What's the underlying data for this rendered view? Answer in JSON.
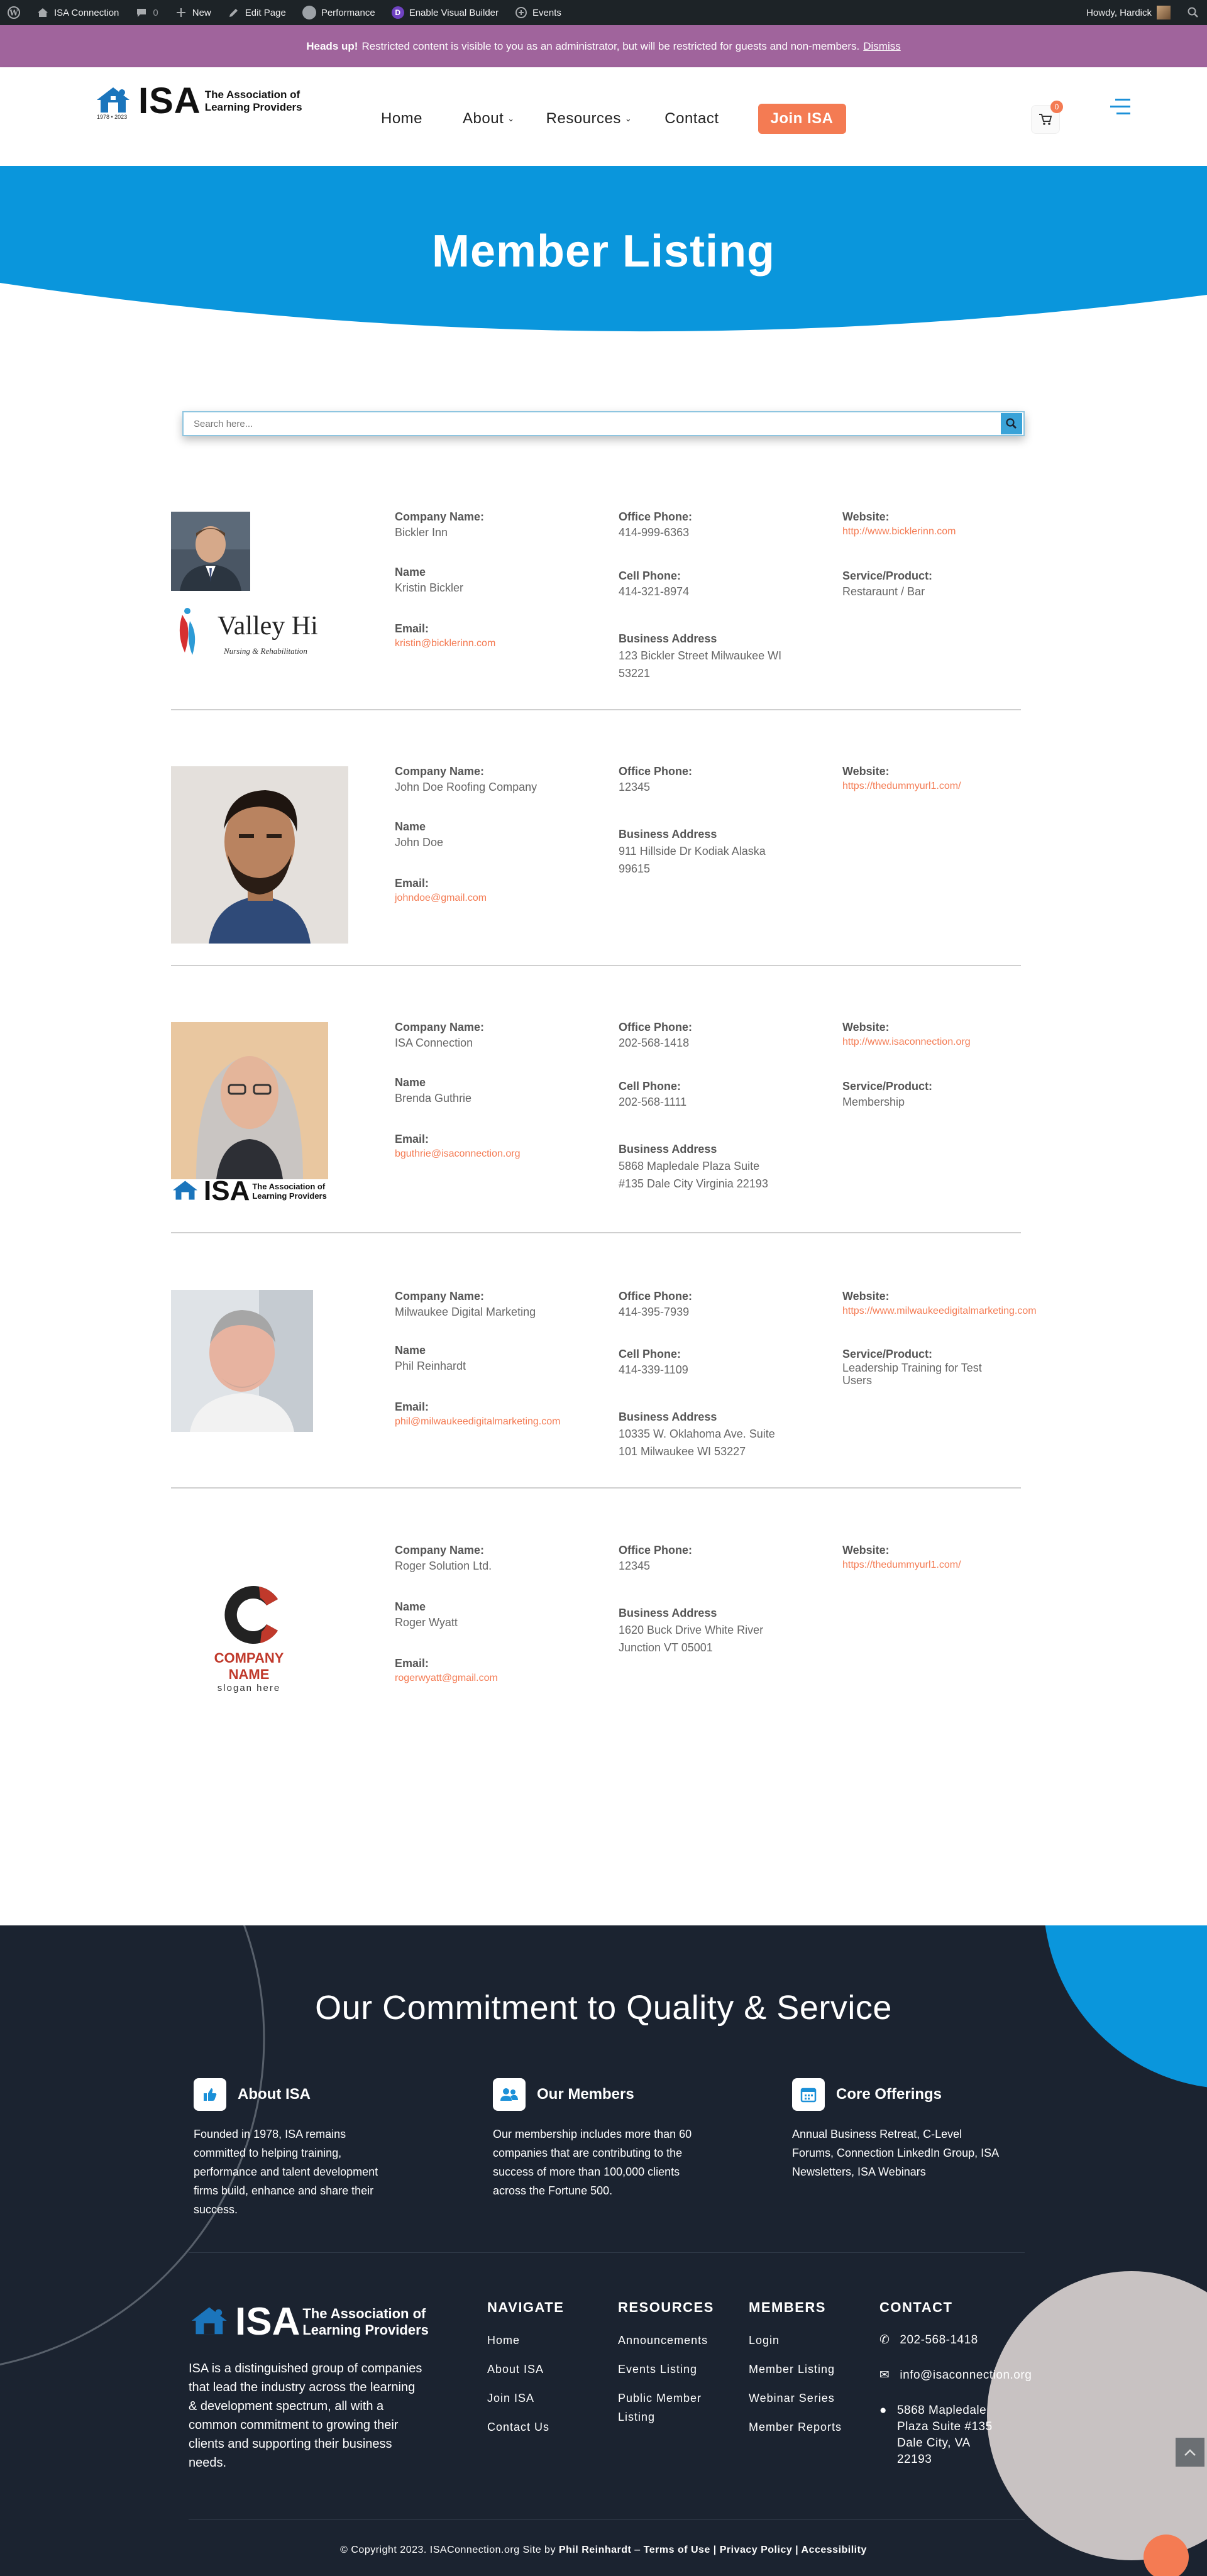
{
  "adminbar": {
    "site": "ISA Connection",
    "comments": "0",
    "new": "New",
    "edit_page": "Edit Page",
    "performance": "Performance",
    "visual_builder": "Enable Visual Builder",
    "events": "Events",
    "howdy": "Howdy, Hardick"
  },
  "notice": {
    "heading": "Heads up!",
    "text": "Restricted content is visible to you as an administrator, but will be restricted for guests and non-members.",
    "dismiss": "Dismiss"
  },
  "logo": {
    "isa": "ISA",
    "line1": "The Association of",
    "line2": "Learning Providers",
    "years": "1978 • 2023"
  },
  "nav": {
    "home": "Home",
    "about": "About",
    "resources": "Resources",
    "contact": "Contact",
    "join": "Join ISA",
    "cart_count": "0"
  },
  "hero": {
    "title": "Member Listing"
  },
  "search": {
    "placeholder": "Search here..."
  },
  "labels": {
    "company": "Company Name:",
    "name": "Name",
    "email": "Email:",
    "office_phone": "Office Phone:",
    "cell_phone": "Cell Phone:",
    "address": "Business Address",
    "website": "Website:",
    "service": "Service/Product:"
  },
  "members": [
    {
      "company": "Bickler Inn",
      "name": "Kristin Bickler",
      "email": "kristin@bicklerinn.com",
      "office_phone": "414-999-6363",
      "cell_phone": "414-321-8974",
      "address_1": "123 Bickler Street Milwaukee WI",
      "address_2": "53221",
      "website": "http://www.bicklerinn.com",
      "service": "Restaraunt / Bar",
      "logo_text": "Valley Hi",
      "logo_sub": "Nursing & Rehabilitation"
    },
    {
      "company": "John Doe Roofing Company",
      "name": "John Doe",
      "email": "johndoe@gmail.com",
      "office_phone": "12345",
      "address_1": "911 Hillside Dr Kodiak Alaska",
      "address_2": "99615",
      "website": "https://thedummyurl1.com/"
    },
    {
      "company": "ISA Connection",
      "name": "Brenda Guthrie",
      "email": "bguthrie@isaconnection.org",
      "office_phone": "202-568-1418",
      "cell_phone": "202-568-1111",
      "address_1": "5868 Mapledale Plaza Suite",
      "address_2": "#135 Dale City Virginia 22193",
      "website": "http://www.isaconnection.org",
      "service": "Membership"
    },
    {
      "company": "Milwaukee Digital Marketing",
      "name": "Phil Reinhardt",
      "email": "phil@milwaukeedigitalmarketing.com",
      "office_phone": "414-395-7939",
      "cell_phone": "414-339-1109",
      "address_1": "10335 W. Oklahoma Ave. Suite",
      "address_2": "101 Milwaukee WI 53227",
      "website": "https://www.milwaukeedigitalmarketing.com",
      "service_1": "Leadership Training for Test",
      "service_2": "Users"
    },
    {
      "company": "Roger Solution Ltd.",
      "name": "Roger Wyatt",
      "email": "rogerwyatt@gmail.com",
      "office_phone": "12345",
      "address_1": "1620 Buck Drive White River",
      "address_2": "Junction VT 05001",
      "website": "https://thedummyurl1.com/",
      "logo_text": "COMPANY NAME",
      "logo_sub": "slogan here"
    }
  ],
  "footer": {
    "title": "Our Commitment to Quality & Service",
    "features": [
      {
        "title": "About ISA",
        "lines": [
          "Founded in 1978, ISA remains",
          "committed to helping training,",
          "performance and talent development",
          "firms build, enhance and share their",
          "success."
        ]
      },
      {
        "title": "Our Members",
        "lines": [
          "Our membership includes more than 60",
          "companies that are contributing to the",
          "success of more than 100,000 clients",
          "across the Fortune 500."
        ]
      },
      {
        "title": "Core Offerings",
        "lines": [
          "Annual Business Retreat, C-Level",
          "Forums, Connection LinkedIn Group, ISA",
          "Newsletters, ISA Webinars"
        ]
      }
    ],
    "desc_lines": [
      "ISA is a distinguished group of companies",
      "that lead the industry across the learning",
      "& development spectrum, all with a",
      "common commitment to growing their",
      "clients and supporting their business",
      "needs."
    ],
    "navigate": {
      "title": "NAVIGATE",
      "links": [
        "Home",
        "About ISA",
        "Join ISA",
        "Contact Us"
      ]
    },
    "resources": {
      "title": "RESOURCES",
      "links": [
        "Announcements",
        "Events Listing",
        "Public Member",
        "Listing"
      ]
    },
    "members": {
      "title": "MEMBERS",
      "links": [
        "Login",
        "Member Listing",
        "Webinar Series",
        "Member Reports"
      ]
    },
    "contact": {
      "title": "CONTACT",
      "phone": "202-568-1418",
      "email": "info@isaconnection.org",
      "addr_lines": [
        "5868 Mapledale",
        "Plaza Suite #135",
        "Dale City, VA",
        "22193"
      ]
    },
    "copyright_pre": "© Copyright 2023. ISAConnection.org Site by",
    "copyright_author": "Phil Reinhardt",
    "copyright_sep": " – ",
    "terms": "Terms of Use",
    "privacy": "Privacy Policy",
    "accessibility": "Accessibility",
    "pipe": " | "
  },
  "colors": {
    "accent": "#f47b53",
    "hero_blue": "#0a96dc",
    "notice_purple": "#a0649c",
    "footer_bg": "#1b2330"
  }
}
